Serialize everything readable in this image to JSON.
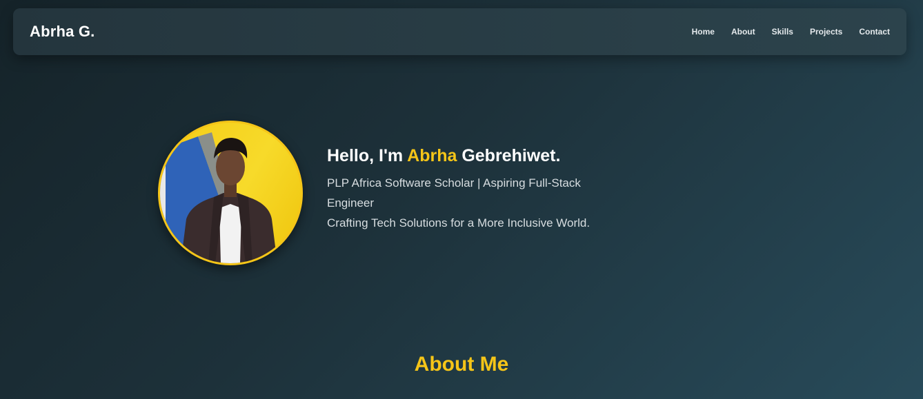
{
  "navbar": {
    "brand": "Abrha G.",
    "links": [
      "Home",
      "About",
      "Skills",
      "Projects",
      "Contact"
    ]
  },
  "hero": {
    "greeting_prefix": "Hello, I'm ",
    "greeting_highlight": "Abrha",
    "greeting_suffix": " Gebrehiwet.",
    "tagline_line1": "PLP Africa Software Scholar | Aspiring Full-Stack Engineer",
    "tagline_line2": "Crafting Tech Solutions for a More Inclusive World."
  },
  "sections": {
    "about_title": "About Me"
  },
  "colors": {
    "accent": "#f5c518",
    "background": "#1d313a",
    "navbar": "#2a3f48"
  }
}
